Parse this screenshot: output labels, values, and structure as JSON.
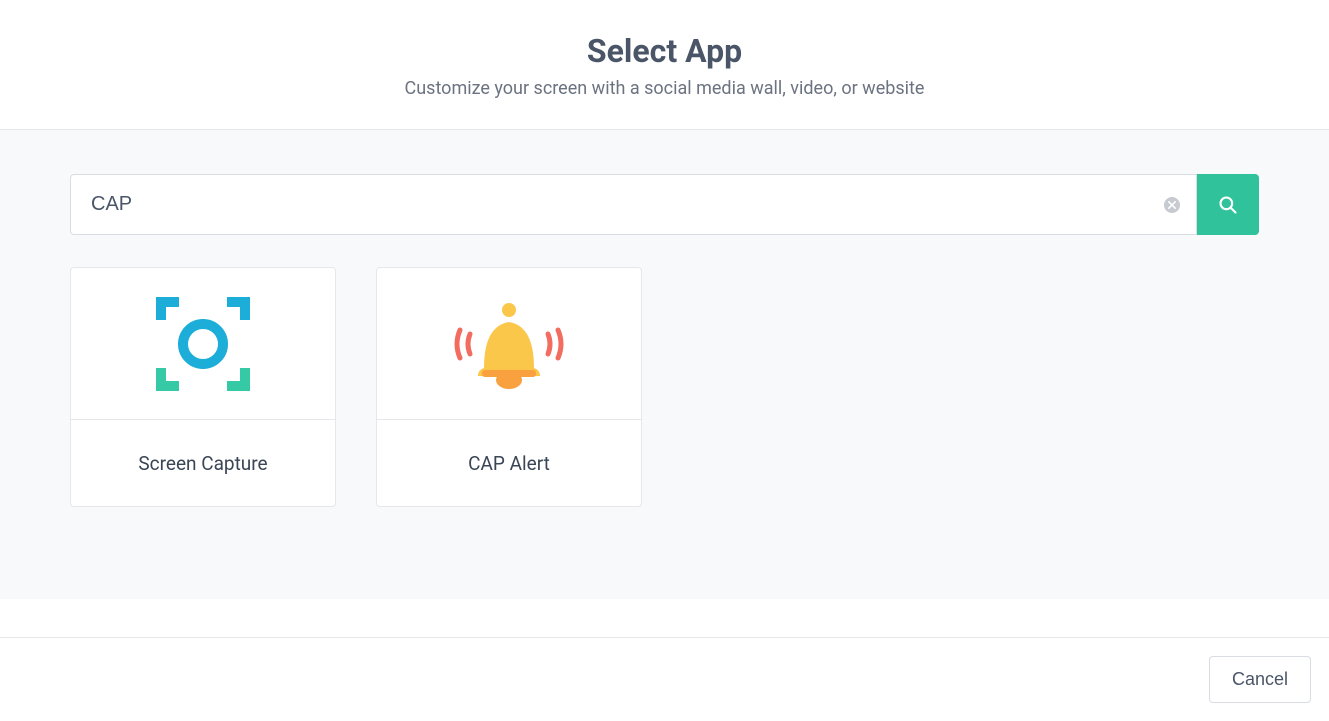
{
  "header": {
    "title": "Select App",
    "subtitle": "Customize your screen with a social media wall, video, or website"
  },
  "search": {
    "value": "CAP",
    "placeholder": ""
  },
  "apps": [
    {
      "id": "screen-capture",
      "label": "Screen Capture",
      "icon": "capture-icon"
    },
    {
      "id": "cap-alert",
      "label": "CAP Alert",
      "icon": "bell-alert-icon"
    }
  ],
  "footer": {
    "cancel_label": "Cancel"
  }
}
